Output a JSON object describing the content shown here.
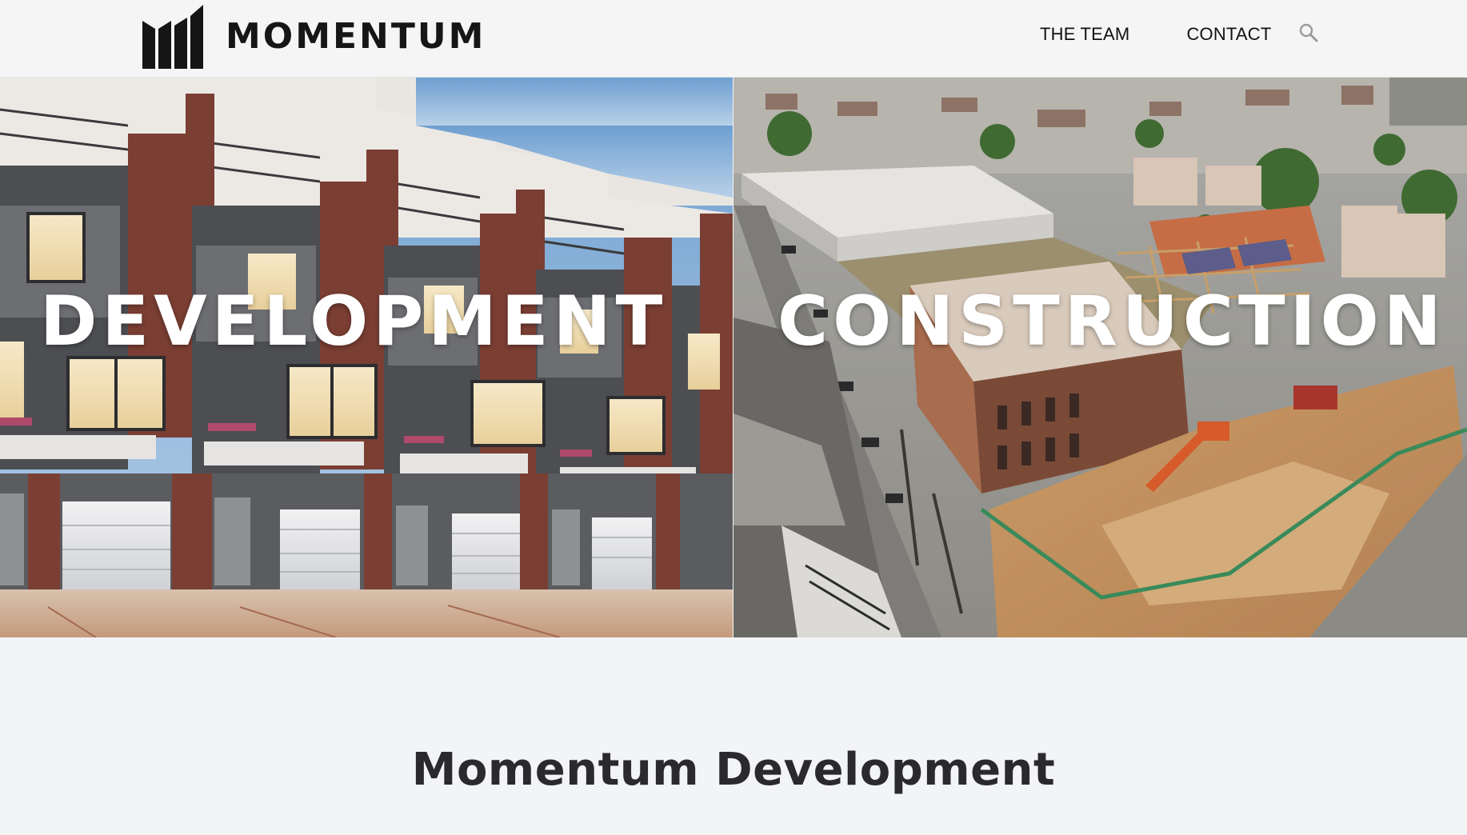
{
  "header": {
    "brand": "MOMENTUM",
    "nav": [
      {
        "label": "THE TEAM"
      },
      {
        "label": "CONTACT"
      }
    ],
    "search_icon": "search-icon"
  },
  "hero": {
    "left_word": "DEVELOPMENT",
    "right_word": "CONSTRUCTION"
  },
  "main": {
    "title": "Momentum Development"
  },
  "colors": {
    "header_bg": "#f5f5f6",
    "text_dark": "#161616",
    "hero_text": "#ffffff",
    "page_bg": "#f3f4f6"
  }
}
